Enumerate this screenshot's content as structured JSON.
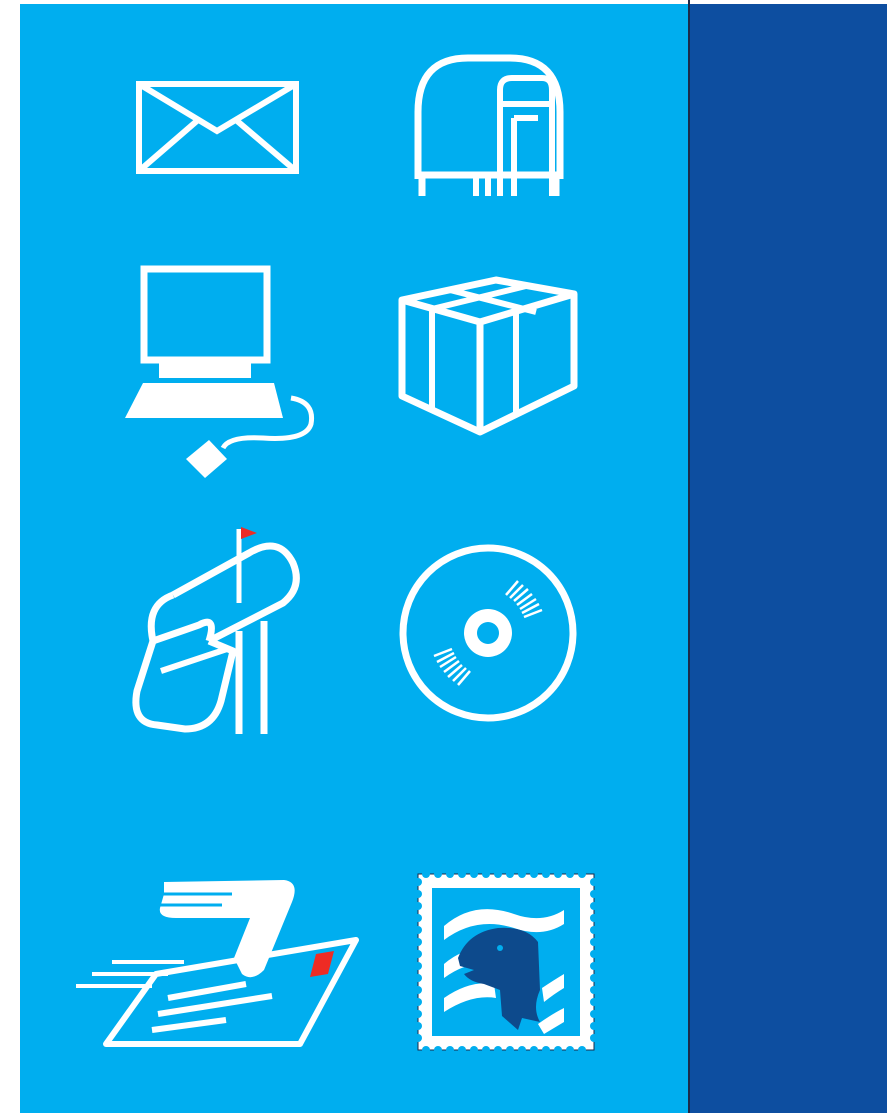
{
  "colors": {
    "panel_left": "#00aeef",
    "panel_right": "#0d4ea0",
    "divider": "#1a2a4a",
    "icon_fill": "#ffffff",
    "flag_red": "#ee2b24",
    "eagle_navy": "#0d4a8c"
  },
  "icons": [
    "envelope-icon",
    "collection-box-icon",
    "computer-icon",
    "package-icon",
    "mailbox-icon",
    "disc-icon",
    "express-mail-icon",
    "stamp-icon"
  ]
}
